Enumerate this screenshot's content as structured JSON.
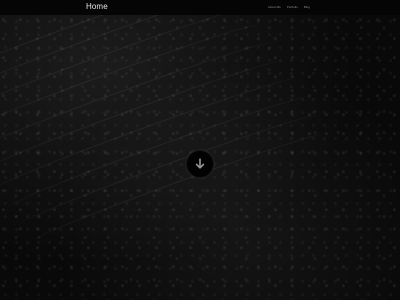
{
  "navbar": {
    "brand": "Home",
    "links": [
      {
        "label": "About Me"
      },
      {
        "label": "Portfolio"
      },
      {
        "label": "Blog"
      }
    ]
  },
  "hero": {
    "background_icon": "dark-sand-dunes-image",
    "scroll_button_icon": "arrow-down-icon"
  },
  "colors": {
    "navbar_background": "#050505",
    "brand_text": "#e6e6e6",
    "nav_link_text": "#8b8b8b",
    "hero_background": "#090909"
  }
}
